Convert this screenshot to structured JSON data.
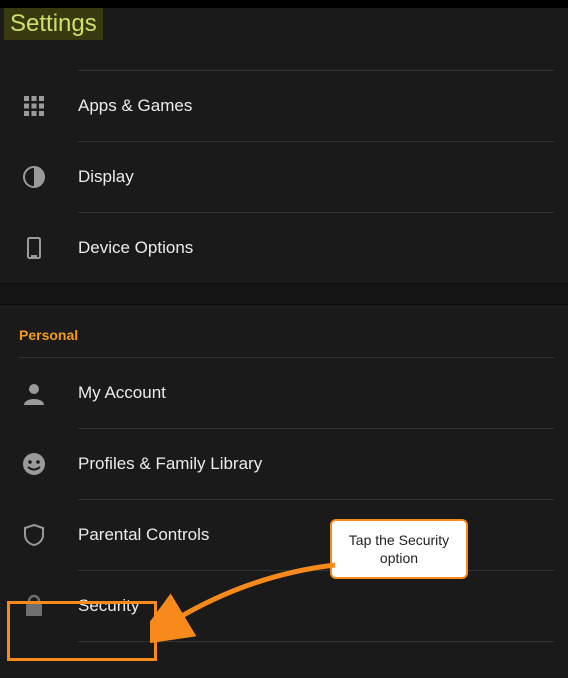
{
  "title": "Settings",
  "device": {
    "items": [
      {
        "label": "Apps & Games"
      },
      {
        "label": "Display"
      },
      {
        "label": "Device Options"
      }
    ]
  },
  "personal": {
    "header": "Personal",
    "items": [
      {
        "label": "My Account"
      },
      {
        "label": "Profiles & Family Library"
      },
      {
        "label": "Parental Controls"
      },
      {
        "label": "Security"
      }
    ]
  },
  "annotation": {
    "callout_text": "Tap the Security option"
  }
}
